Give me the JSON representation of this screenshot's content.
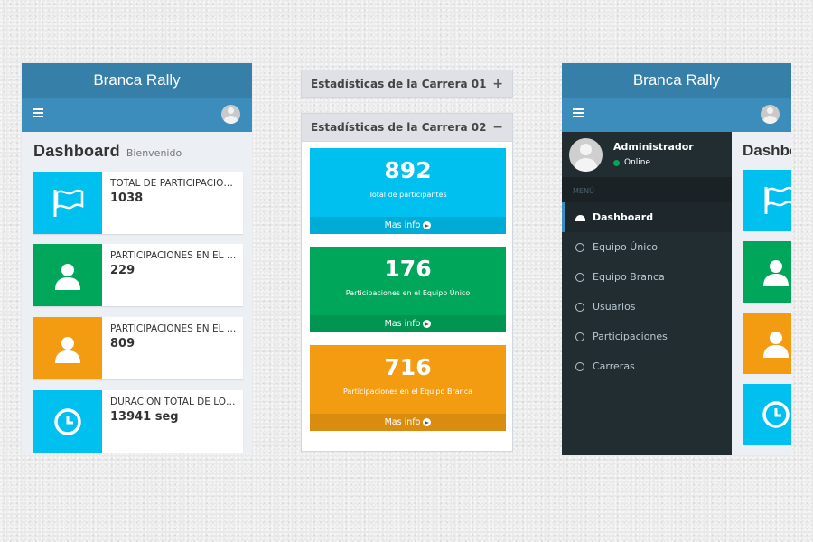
{
  "left_panel": {
    "brand": "Branca Rally",
    "title": "Dashboard",
    "subtitle": "Bienvenido",
    "boxes": [
      {
        "text": "TOTAL DE PARTICIPACIONES",
        "number": "1038",
        "color": "#00c0ef",
        "icon": "flag-icon"
      },
      {
        "text": "PARTICIPACIONES EN EL EQUIPO ÚNICO",
        "number": "229",
        "color": "#00a65a",
        "icon": "user-icon"
      },
      {
        "text": "PARTICIPACIONES EN EL EQUIPO BRANCA",
        "number": "809",
        "color": "#f39c12",
        "icon": "user-icon"
      },
      {
        "text": "DURACIÓN TOTAL DE LOS RECORRIDOS",
        "number": "13941 seg",
        "color": "#00c0ef",
        "icon": "clock-icon"
      }
    ]
  },
  "middle_panel": {
    "box1_title": "Estadísticas de la Carrera 01",
    "box1_tool": "+",
    "box2_title": "Estadísticas de la Carrera 02",
    "box2_tool": "−",
    "stats": [
      {
        "number": "892",
        "label": "Total de participantes",
        "footer": "Mas info",
        "color": "#00c0ef"
      },
      {
        "number": "176",
        "label": "Participaciones en el Equipo Único",
        "footer": "Mas info",
        "color": "#00a65a"
      },
      {
        "number": "716",
        "label": "Participaciones en el Equipo Branca",
        "footer": "Mas info",
        "color": "#f39c12"
      }
    ]
  },
  "right_panel": {
    "brand": "Branca Rally",
    "user_name": "Administrador",
    "user_status": "Online",
    "menu_header": "MENÚ",
    "menu": [
      {
        "label": "Dashboard",
        "icon": "dashboard-icon",
        "active": true
      },
      {
        "label": "Equipo Único",
        "icon": "whatsapp-icon"
      },
      {
        "label": "Equipo Branca",
        "icon": "whatsapp-icon"
      },
      {
        "label": "Usuarios",
        "icon": "circle-icon"
      },
      {
        "label": "Participaciones",
        "icon": "circle-icon"
      },
      {
        "label": "Carreras",
        "icon": "circle-icon"
      }
    ],
    "content_title": "Dashboard"
  }
}
